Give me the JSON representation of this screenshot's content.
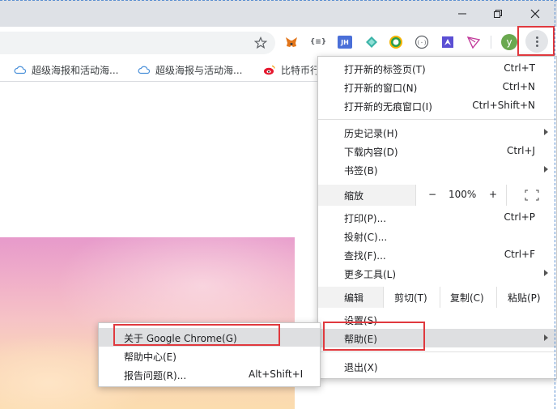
{
  "window": {
    "minimize_icon": "minimize-icon",
    "restore_icon": "restore-icon",
    "close_icon": "close-icon"
  },
  "toolbar": {
    "star_icon": "bookmark-star-icon",
    "extensions": [
      {
        "name": "metamask-fox-icon",
        "text": ""
      },
      {
        "name": "json-braces-icon",
        "text": "{≡}"
      },
      {
        "name": "jh-extension-icon",
        "text": "JH"
      },
      {
        "name": "diamond-extension-icon",
        "text": ""
      },
      {
        "name": "circle-check-extension-icon",
        "text": ""
      },
      {
        "name": "code-circle-extension-icon",
        "text": ""
      },
      {
        "name": "arrow-square-extension-icon",
        "text": ""
      },
      {
        "name": "tron-triangle-icon",
        "text": ""
      }
    ],
    "profile_initial": "y",
    "menu_icon": "kebab-menu-icon"
  },
  "bookmarks": [
    {
      "label": "超级海报和活动海...",
      "icon": "cloud-icon"
    },
    {
      "label": "超级海报与活动海...",
      "icon": "cloud-icon"
    },
    {
      "label": "比特币行",
      "icon": "weibo-icon"
    }
  ],
  "menu": {
    "items": [
      {
        "label": "打开新的标签页(T)",
        "shortcut": "Ctrl+T"
      },
      {
        "label": "打开新的窗口(N)",
        "shortcut": "Ctrl+N"
      },
      {
        "label": "打开新的无痕窗口(I)",
        "shortcut": "Ctrl+Shift+N"
      },
      {
        "label": "历史记录(H)",
        "shortcut": ""
      },
      {
        "label": "下载内容(D)",
        "shortcut": "Ctrl+J"
      },
      {
        "label": "书签(B)",
        "shortcut": ""
      },
      {
        "label": "打印(P)...",
        "shortcut": "Ctrl+P"
      },
      {
        "label": "投射(C)...",
        "shortcut": ""
      },
      {
        "label": "查找(F)...",
        "shortcut": "Ctrl+F"
      },
      {
        "label": "更多工具(L)",
        "shortcut": ""
      },
      {
        "label": "设置(S)",
        "shortcut": ""
      },
      {
        "label": "帮助(E)",
        "shortcut": ""
      },
      {
        "label": "退出(X)",
        "shortcut": ""
      }
    ],
    "zoom": {
      "label": "缩放",
      "minus": "−",
      "value": "100%",
      "plus": "+",
      "fullscreen_icon": "fullscreen-icon"
    },
    "edit": {
      "label": "编辑",
      "cut": "剪切(T)",
      "copy": "复制(C)",
      "paste": "粘贴(P)"
    }
  },
  "help_submenu": {
    "items": [
      {
        "label": "关于 Google Chrome(G)",
        "shortcut": ""
      },
      {
        "label": "帮助中心(E)",
        "shortcut": ""
      },
      {
        "label": "报告问题(R)...",
        "shortcut": "Alt+Shift+I"
      }
    ]
  },
  "colors": {
    "annotation_red": "#e0393e",
    "menu_highlight": "#dedfe1",
    "profile_green": "#6aa84f"
  }
}
